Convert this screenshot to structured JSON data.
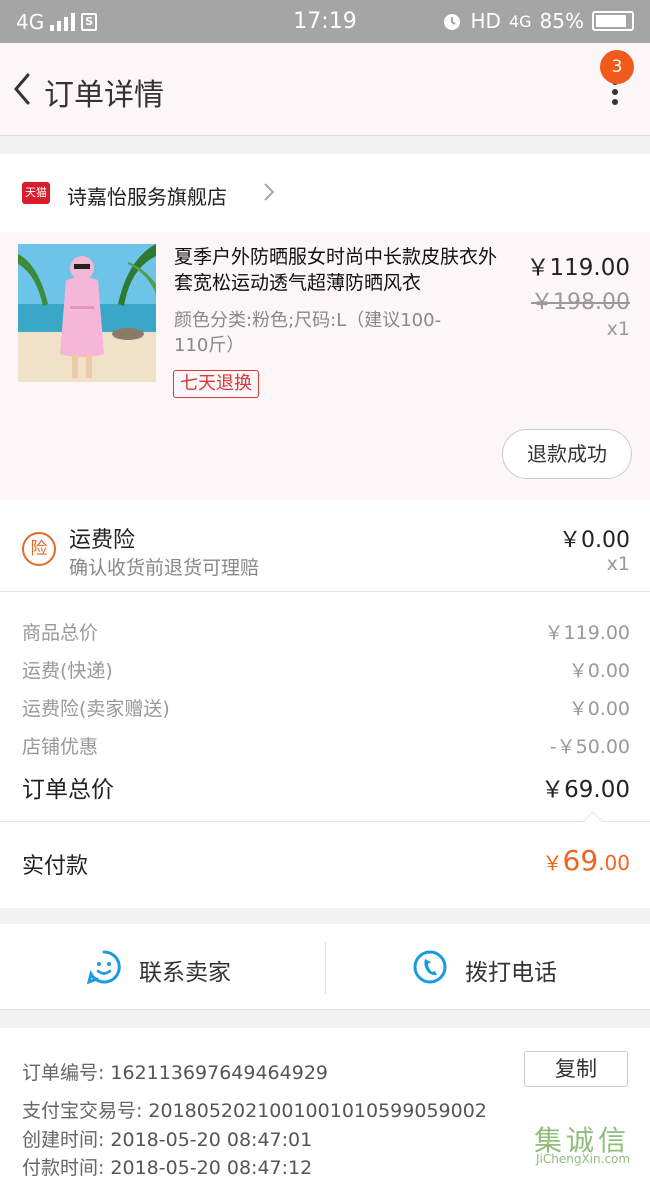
{
  "status_bar": {
    "network": "4G",
    "time": "17:19",
    "hd": "HD",
    "network_right": "4G",
    "battery": "85%"
  },
  "nav": {
    "title": "订单详情",
    "badge": "3"
  },
  "store": {
    "logo_text": "天猫",
    "name": "诗嘉怡服务旗舰店"
  },
  "product": {
    "title": "夏季户外防晒服女时尚中长款皮肤衣外套宽松运动透气超薄防晒风衣",
    "sku": "颜色分类:粉色;尺码:L（建议100-110斤）",
    "tag": "七天退换",
    "price": "￥119.00",
    "original_price": "￥198.00",
    "quantity": "x1",
    "refund_status": "退款成功"
  },
  "insurance": {
    "icon_text": "险",
    "name": "运费险",
    "description": "确认收货前退货可理赔",
    "price": "￥0.00",
    "quantity": "x1"
  },
  "summary": {
    "rows": [
      {
        "label": "商品总价",
        "value": "￥119.00"
      },
      {
        "label": "运费(快递)",
        "value": "￥0.00"
      },
      {
        "label": "运费险(卖家赠送)",
        "value": "￥0.00"
      },
      {
        "label": "店铺优惠",
        "value": "-￥50.00"
      }
    ],
    "total_label": "订单总价",
    "total_value": "￥69.00"
  },
  "payment": {
    "label": "实付款",
    "symbol": "￥",
    "integer": "69",
    "decimal": ".00"
  },
  "actions": {
    "contact_seller": "联系卖家",
    "call_phone": "拨打电话"
  },
  "order_info": {
    "order_no_label": "订单编号:",
    "order_no": "162113697649464929",
    "copy_label": "复制",
    "alipay_label": "支付宝交易号:",
    "alipay_no": "2018052021001001010599059002",
    "created_label": "创建时间:",
    "created_time": "2018-05-20 08:47:01",
    "paid_label": "付款时间:",
    "paid_time": "2018-05-20 08:47:12"
  },
  "watermark": {
    "text_cn": "集诚信",
    "text_en": "JiChengXin.com"
  },
  "colors": {
    "accent_orange": "#f0641e",
    "tmall_red": "#d81e2c",
    "action_blue": "#1a9be0"
  }
}
